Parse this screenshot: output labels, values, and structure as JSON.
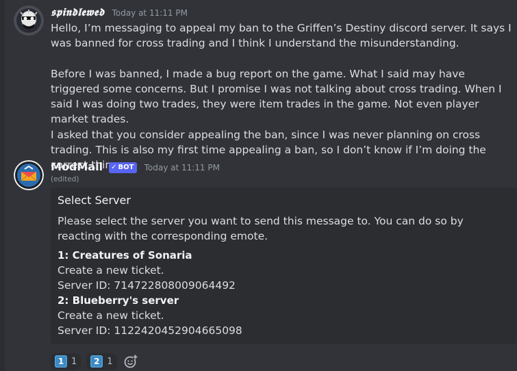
{
  "messages": [
    {
      "username": "𝖘𝖕𝖎𝖓𝖉𝖑𝖊𝖜𝖊𝖉",
      "timestamp": "Today at 11:11 PM",
      "paragraphs": [
        "Hello, I’m messaging to appeal my ban to the Griffen’s Destiny discord server. It says I was banned for cross trading and I think I understand the misunderstanding.",
        "Before I was banned, I made a bug report on the game. What I said may have triggered some concerns. But I promise I was not talking about cross trading. When I said I was doing two trades, they were item trades in the game. Not even player market trades.",
        "I asked that you consider appealing the ban, since I was never planning on cross trading. This is also my first time appealing a ban, so I don’t know if I’m doing the correct thing."
      ]
    },
    {
      "username": "ModMail",
      "bot_tag": "BOT",
      "timestamp": "Today at 11:11 PM",
      "edited": "(edited)",
      "embed": {
        "title": "Select Server",
        "description": "Please select the server you want to send this message to. You can do so by reacting with the corresponding emote.",
        "fields": [
          {
            "name": "1: Creatures of Sonaria",
            "line1": "Create a new ticket.",
            "line2": "Server ID: 714722808009064492"
          },
          {
            "name": "2: Blueberry's server",
            "line1": "Create a new ticket.",
            "line2": "Server ID: 1122420452904665098"
          }
        ]
      },
      "reactions": [
        {
          "emoji": "1",
          "count": "1"
        },
        {
          "emoji": "2",
          "count": "1"
        }
      ]
    }
  ],
  "colors": {
    "background": "#313338",
    "embed_background": "#2b2d31",
    "bot_tag": "#5865f2",
    "keycap": "#3b88c3"
  },
  "icons": [
    "add-reaction-icon",
    "verified-check-icon"
  ]
}
